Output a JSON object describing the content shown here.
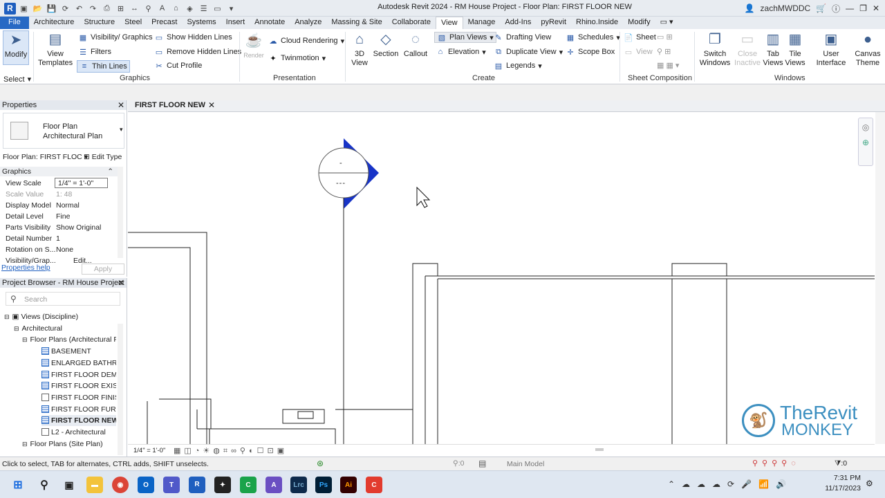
{
  "window": {
    "title": "Autodesk Revit 2024 - RM House Project - Floor Plan: FIRST FLOOR NEW",
    "user": "zachMWDDC",
    "logo_letter": "R"
  },
  "tabs": [
    "File",
    "Architecture",
    "Structure",
    "Steel",
    "Precast",
    "Systems",
    "Insert",
    "Annotate",
    "Analyze",
    "Massing & Site",
    "Collaborate",
    "View",
    "Manage",
    "Add-Ins",
    "pyRevit",
    "Rhino.Inside",
    "Modify"
  ],
  "active_tab": "View",
  "ribbon": {
    "modify": "Modify",
    "select": "Select",
    "view_templates": [
      "View",
      "Templates"
    ],
    "vis_graphics": "Visibility/ Graphics",
    "filters": "Filters",
    "thin_lines": "Thin Lines",
    "show_hidden": "Show Hidden Lines",
    "remove_hidden": "Remove Hidden Lines",
    "cut_profile": "Cut Profile",
    "graphics": "Graphics",
    "render": "Render",
    "cloud_rendering": "Cloud Rendering",
    "twinmotion": "Twinmotion",
    "presentation": "Presentation",
    "view3d": [
      "3D",
      "View"
    ],
    "section": "Section",
    "callout": "Callout",
    "plan_views": "Plan Views",
    "elevation": "Elevation",
    "drafting_view": "Drafting View",
    "duplicate_view": "Duplicate View",
    "legends": "Legends",
    "schedules": "Schedules",
    "scope_box": "Scope Box",
    "create": "Create",
    "sheet": "Sheet",
    "view": "View",
    "sheet_composition": "Sheet Composition",
    "switch_windows": [
      "Switch",
      "Windows"
    ],
    "close_inactive": [
      "Close",
      "Inactive"
    ],
    "tab_views": [
      "Tab",
      "Views"
    ],
    "tile_views": [
      "Tile",
      "Views"
    ],
    "windows": "Windows",
    "user_interface": [
      "User",
      "Interface"
    ],
    "canvas_theme": [
      "Canvas",
      "Theme"
    ]
  },
  "properties": {
    "header": "Properties",
    "type_name": "Floor Plan",
    "type_sub": "Architectural Plan",
    "selector": "Floor Plan: FIRST FLOC",
    "edit_type": "Edit Type",
    "group": "Graphics",
    "rows": [
      {
        "k": "View Scale",
        "v": "1/4\" = 1'-0\""
      },
      {
        "k": "Scale Value",
        "v": "1: 48"
      },
      {
        "k": "Display Model",
        "v": "Normal"
      },
      {
        "k": "Detail Level",
        "v": "Fine"
      },
      {
        "k": "Parts Visibility",
        "v": "Show Original"
      },
      {
        "k": "Detail Number",
        "v": "1"
      },
      {
        "k": "Rotation on S...",
        "v": "None"
      },
      {
        "k": "Visibility/Grap...",
        "v": "Edit..."
      }
    ],
    "help": "Properties help",
    "apply": "Apply"
  },
  "browser": {
    "header": "Project Browser - RM House Project",
    "search_placeholder": "Search",
    "items": [
      {
        "label": "Views (Discipline)",
        "lvl": 0
      },
      {
        "label": "Architectural",
        "lvl": 1
      },
      {
        "label": "Floor Plans (Architectural Pl",
        "lvl": 2
      },
      {
        "label": "BASEMENT",
        "lvl": 3
      },
      {
        "label": "ENLARGED BATHROO",
        "lvl": 3
      },
      {
        "label": "FIRST FLOOR DEMO",
        "lvl": 3
      },
      {
        "label": "FIRST FLOOR EXISTIN",
        "lvl": 3
      },
      {
        "label": "FIRST FLOOR FINISH",
        "lvl": 3
      },
      {
        "label": "FIRST FLOOR FURNIT",
        "lvl": 3
      },
      {
        "label": "FIRST FLOOR NEW",
        "lvl": 3
      },
      {
        "label": "L2 - Architectural",
        "lvl": 3
      },
      {
        "label": "Floor Plans (Site Plan)",
        "lvl": 2
      }
    ]
  },
  "document_tab": "FIRST FLOOR NEW",
  "elevation_marker": {
    "top": "-",
    "bottom": "---"
  },
  "view_control_scale": "1/4\" = 1'-0\"",
  "status": {
    "hint": "Click to select, TAB for alternates, CTRL adds, SHIFT unselects.",
    "model": "Main Model",
    "count1": ":0",
    "count2": ":0"
  },
  "watermark": {
    "line1": "TheRevit",
    "line2": "MONKEY"
  },
  "taskbar": {
    "time": "7:31 PM",
    "date": "11/17/2023"
  },
  "colors": {
    "accent": "#2769c4",
    "marker": "#1834c7",
    "watermark": "#3c8fc0"
  }
}
